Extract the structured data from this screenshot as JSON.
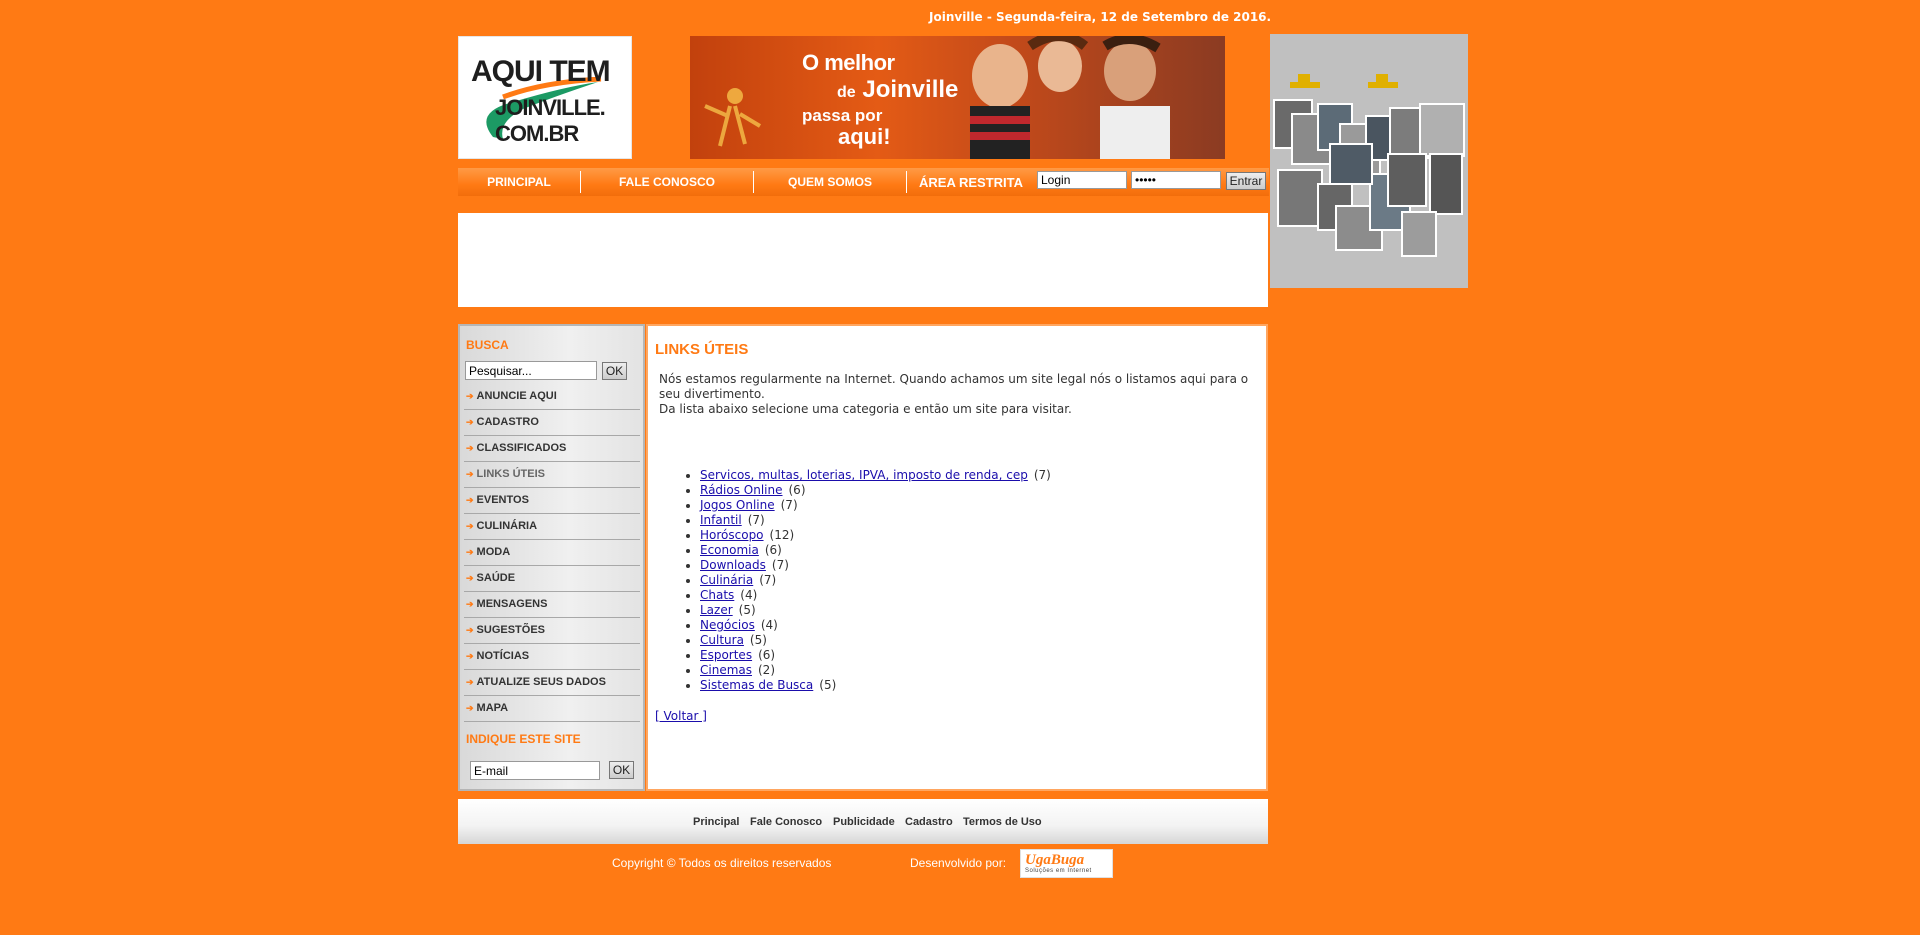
{
  "header": {
    "date_line": "Joinville - Segunda-feira, 12 de Setembro de 2016.",
    "logo": {
      "line1": "AQUI TEM",
      "line2": "JOINVILLE.",
      "line3": "COM.BR"
    },
    "banner": {
      "line1": "O melhor",
      "line2_small": "de",
      "line2": "Joinville",
      "line3": "passa por",
      "line4": "aqui!"
    }
  },
  "nav": {
    "items": [
      "PRINCIPAL",
      "FALE CONOSCO",
      "QUEM SOMOS"
    ],
    "restricted_label": "ÁREA RESTRITA",
    "login_value": "Login",
    "password_value": "•••••",
    "enter_label": "Entrar"
  },
  "sidebar": {
    "search_title": "BUSCA",
    "search_value": "Pesquisar...",
    "search_button": "OK",
    "items": [
      {
        "label": "ANUNCIE AQUI"
      },
      {
        "label": "CADASTRO"
      },
      {
        "label": "CLASSIFICADOS"
      },
      {
        "label": "LINKS ÚTEIS"
      },
      {
        "label": "EVENTOS"
      },
      {
        "label": "CULINÁRIA"
      },
      {
        "label": "MODA"
      },
      {
        "label": "SAÚDE"
      },
      {
        "label": "MENSAGENS"
      },
      {
        "label": "SUGESTÕES"
      },
      {
        "label": "NOTÍCIAS"
      },
      {
        "label": "ATUALIZE SEUS DADOS"
      },
      {
        "label": "MAPA"
      }
    ],
    "recommend_title": "INDIQUE ESTE SITE",
    "email_value": "E-mail",
    "email_button": "OK"
  },
  "content": {
    "title": "LINKS ÚTEIS",
    "intro1": "Nós estamos regularmente na Internet. Quando achamos um site legal nós o listamos aqui para o seu divertimento.",
    "intro2": "Da lista abaixo selecione uma categoria e então um site para visitar.",
    "links": [
      {
        "label": "Servicos, multas, loterias, IPVA, imposto de renda, cep",
        "count": "(7)"
      },
      {
        "label": "Rádios Online",
        "count": "(6)"
      },
      {
        "label": "Jogos Online",
        "count": "(7)"
      },
      {
        "label": "Infantil",
        "count": "(7)"
      },
      {
        "label": "Horóscopo",
        "count": "(12)"
      },
      {
        "label": "Economia",
        "count": "(6)"
      },
      {
        "label": "Downloads",
        "count": "(7)"
      },
      {
        "label": "Culinária",
        "count": "(7)"
      },
      {
        "label": "Chats",
        "count": "(4)"
      },
      {
        "label": "Lazer",
        "count": "(5)"
      },
      {
        "label": "Negócios",
        "count": "(4)"
      },
      {
        "label": "Cultura",
        "count": "(5)"
      },
      {
        "label": "Esportes",
        "count": "(6)"
      },
      {
        "label": "Cinemas",
        "count": "(2)"
      },
      {
        "label": "Sistemas de Busca",
        "count": "(5)"
      }
    ],
    "back_label": "[ Voltar ]"
  },
  "footer": {
    "links": [
      "Principal",
      "Fale Conosco",
      "Publicidade",
      "Cadastro",
      "Termos de Uso"
    ],
    "copyright": "Copyright © Todos os direitos reservados",
    "developed_by": "Desenvolvido por:",
    "dev_logo_text": "UgaBuga",
    "dev_logo_sub": "Soluções em Internet"
  },
  "colors": {
    "accent": "#ff7a14",
    "link": "#1a0dab"
  }
}
